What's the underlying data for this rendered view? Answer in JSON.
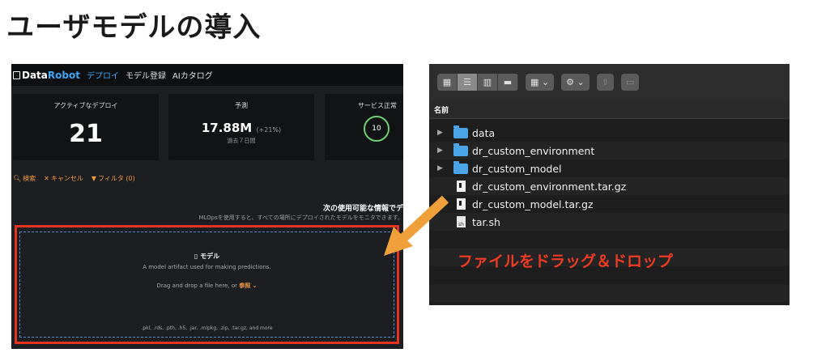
{
  "slide": {
    "title": "ユーザモデルの導入"
  },
  "datarobot": {
    "logo_text": "Data",
    "logo_accent": "Robot",
    "nav": [
      "デプロイ",
      "モデル登録",
      "AIカタログ"
    ],
    "cards": {
      "active_label": "アクティブなデプロイ",
      "active_value": "21",
      "predictions_label": "予測",
      "predictions_value": "17.88M",
      "predictions_trend": "(+21%)",
      "predictions_period": "過去７日間",
      "service_label": "サービス正常",
      "service_value": "10"
    },
    "toolbar": {
      "search": "検索",
      "cancel": "キャンセル",
      "filter": "フィルタ (0)"
    },
    "info_title": "次の使用可能な情報でデ",
    "info_desc": "MLOpsを使用すると、すべての場所にデプロイされたモデルをモニタできます。",
    "dropzone": {
      "title": "モデル",
      "description": "A model artifact used for making predictions.",
      "drag_text": "Drag and drop a file here, or",
      "browse": "参照",
      "formats": ".pkl, .rds, .pth, .h5, .jar, .mlpkg, .zip, .tar.gz, and more"
    }
  },
  "finder": {
    "column_name": "名前",
    "items": [
      {
        "name": "data",
        "type": "folder"
      },
      {
        "name": "dr_custom_environment",
        "type": "folder"
      },
      {
        "name": "dr_custom_model",
        "type": "folder"
      },
      {
        "name": "dr_custom_environment.tar.gz",
        "type": "archive"
      },
      {
        "name": "dr_custom_model.tar.gz",
        "type": "archive"
      },
      {
        "name": "tar.sh",
        "type": "script"
      }
    ]
  },
  "annotation": {
    "label": "ファイルをドラッグ＆ドロップ"
  },
  "colors": {
    "accent_orange": "#f09a3e",
    "highlight_red": "#e53322",
    "link_blue": "#3fa7f5"
  }
}
